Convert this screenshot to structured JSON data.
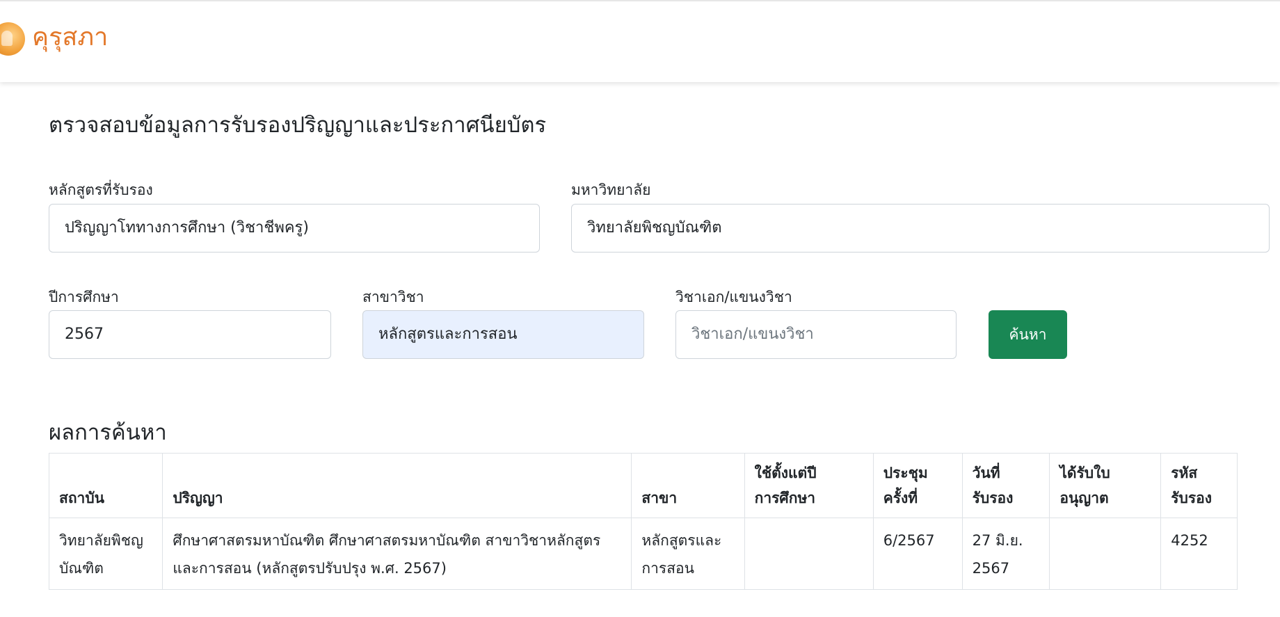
{
  "navbar": {
    "brand": "คุรุสภา"
  },
  "page": {
    "title": "ตรวจสอบข้อมูลการรับรองปริญญาและประกาศนียบัตร"
  },
  "form": {
    "course_label": "หลักสูตรที่รับรอง",
    "course_value": "ปริญญาโททางการศึกษา (วิชาชีพครู)",
    "university_label": "มหาวิทยาลัย",
    "university_value": "วิทยาลัยพิชญบัณฑิต",
    "year_label": "ปีการศึกษา",
    "year_value": "2567",
    "branch_label": "สาขาวิชา",
    "branch_value": "หลักสูตรและการสอน",
    "major_label": "วิชาเอก/แขนงวิชา",
    "major_placeholder": "วิชาเอก/แขนงวิชา",
    "search_button": "ค้นหา"
  },
  "results": {
    "title": "ผลการค้นหา",
    "headers": {
      "institution": "สถาบัน",
      "degree": "ปริญญา",
      "branch": "สาขา",
      "since_line1": "ใช้ตั้งแต่ปี",
      "since_line2": "การศึกษา",
      "meeting_line1": "ประชุม",
      "meeting_line2": "ครั้งที่",
      "date_line1": "วันที่",
      "date_line2": "รับรอง",
      "license_line1": "ได้รับใบ",
      "license_line2": "อนุญาต",
      "code_line1": "รหัส",
      "code_line2": "รับรอง"
    },
    "rows": [
      {
        "institution": "วิทยาลัยพิชญบัณฑิต",
        "degree": "ศึกษาศาสตรมหาบัณฑิต ศึกษาศาสตรมหาบัณฑิต สาขาวิชาหลักสูตรและการสอน (หลักสูตรปรับปรุง พ.ศ. 2567)",
        "branch": "หลักสูตรและการสอน",
        "since": "",
        "meeting": "6/2567",
        "date": "27 มิ.ย. 2567",
        "license": "",
        "code": "4252"
      }
    ]
  }
}
